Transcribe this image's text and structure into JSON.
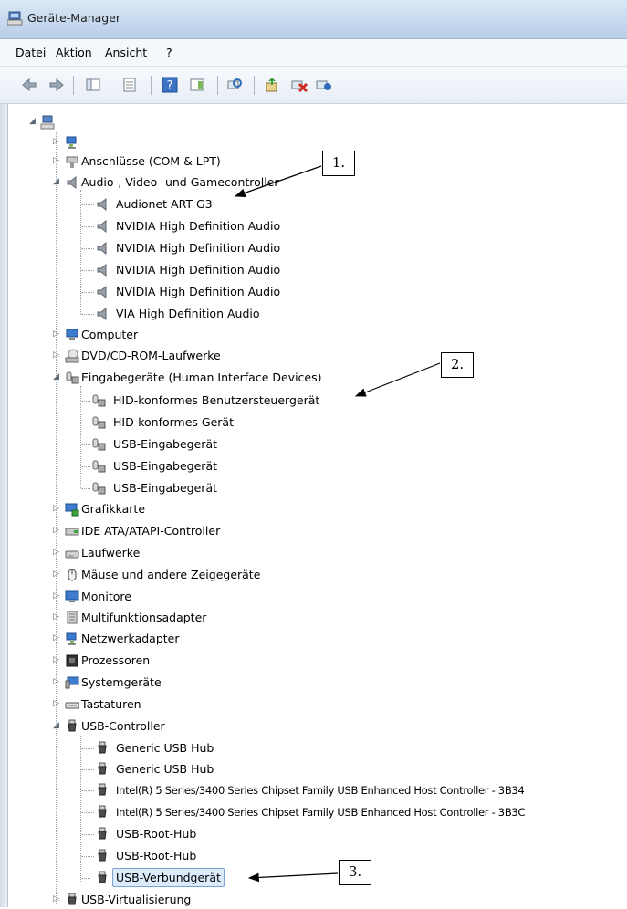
{
  "window": {
    "title": "Geräte-Manager"
  },
  "menu": [
    "Datei",
    "Aktion",
    "Ansicht",
    "?"
  ],
  "toolbar": {
    "buttons": [
      "back-icon",
      "forward-icon",
      "console-tree-icon",
      "properties-sheet-icon",
      "help-icon",
      "action-pane-icon",
      "scan-hardware-icon",
      "update-driver-icon",
      "uninstall-icon",
      "enable-device-icon"
    ]
  },
  "tree": {
    "root_label": "",
    "categories": [
      {
        "label": "",
        "icon": "network-pc-icon"
      },
      {
        "label": "Anschlüsse (COM & LPT)",
        "icon": "port-icon"
      },
      {
        "label": "Audio-, Video- und Gamecontroller",
        "icon": "speaker-icon",
        "expanded": true,
        "children": [
          "Audionet ART G3",
          "NVIDIA High Definition Audio",
          "NVIDIA High Definition Audio",
          "NVIDIA High Definition Audio",
          "NVIDIA High Definition Audio",
          "VIA High Definition Audio"
        ]
      },
      {
        "label": "Computer",
        "icon": "computer-icon"
      },
      {
        "label": "DVD/CD-ROM-Laufwerke",
        "icon": "disc-drive-icon"
      },
      {
        "label": "Eingabegeräte (Human Interface Devices)",
        "icon": "hid-icon",
        "expanded": true,
        "children": [
          "HID-konformes Benutzersteuergerät",
          "HID-konformes Gerät",
          "USB-Eingabegerät",
          "USB-Eingabegerät",
          "USB-Eingabegerät"
        ]
      },
      {
        "label": "Grafikkarte",
        "icon": "display-adapter-icon"
      },
      {
        "label": "IDE ATA/ATAPI-Controller",
        "icon": "ide-controller-icon"
      },
      {
        "label": "Laufwerke",
        "icon": "hard-drive-icon"
      },
      {
        "label": "Mäuse und andere Zeigegeräte",
        "icon": "mouse-icon"
      },
      {
        "label": "Monitore",
        "icon": "monitor-icon"
      },
      {
        "label": "Multifunktionsadapter",
        "icon": "multifunction-icon"
      },
      {
        "label": "Netzwerkadapter",
        "icon": "network-adapter-icon"
      },
      {
        "label": "Prozessoren",
        "icon": "processor-icon"
      },
      {
        "label": "Systemgeräte",
        "icon": "system-device-icon"
      },
      {
        "label": "Tastaturen",
        "icon": "keyboard-icon"
      },
      {
        "label": "USB-Controller",
        "icon": "usb-icon",
        "expanded": true,
        "children": [
          "Generic USB Hub",
          "Generic USB Hub",
          "Intel(R) 5 Series/3400 Series Chipset Family USB Enhanced Host Controller - 3B34",
          "Intel(R) 5 Series/3400 Series Chipset Family USB Enhanced Host Controller - 3B3C",
          "USB-Root-Hub",
          "USB-Root-Hub",
          "USB-Verbundgerät"
        ]
      },
      {
        "label": "USB-Virtualisierung",
        "icon": "usb-icon"
      }
    ]
  },
  "callouts": [
    "1.",
    "2.",
    "3."
  ],
  "colors": {
    "selection_bg": "#dcebfc",
    "selection_border": "#7da2ce"
  }
}
